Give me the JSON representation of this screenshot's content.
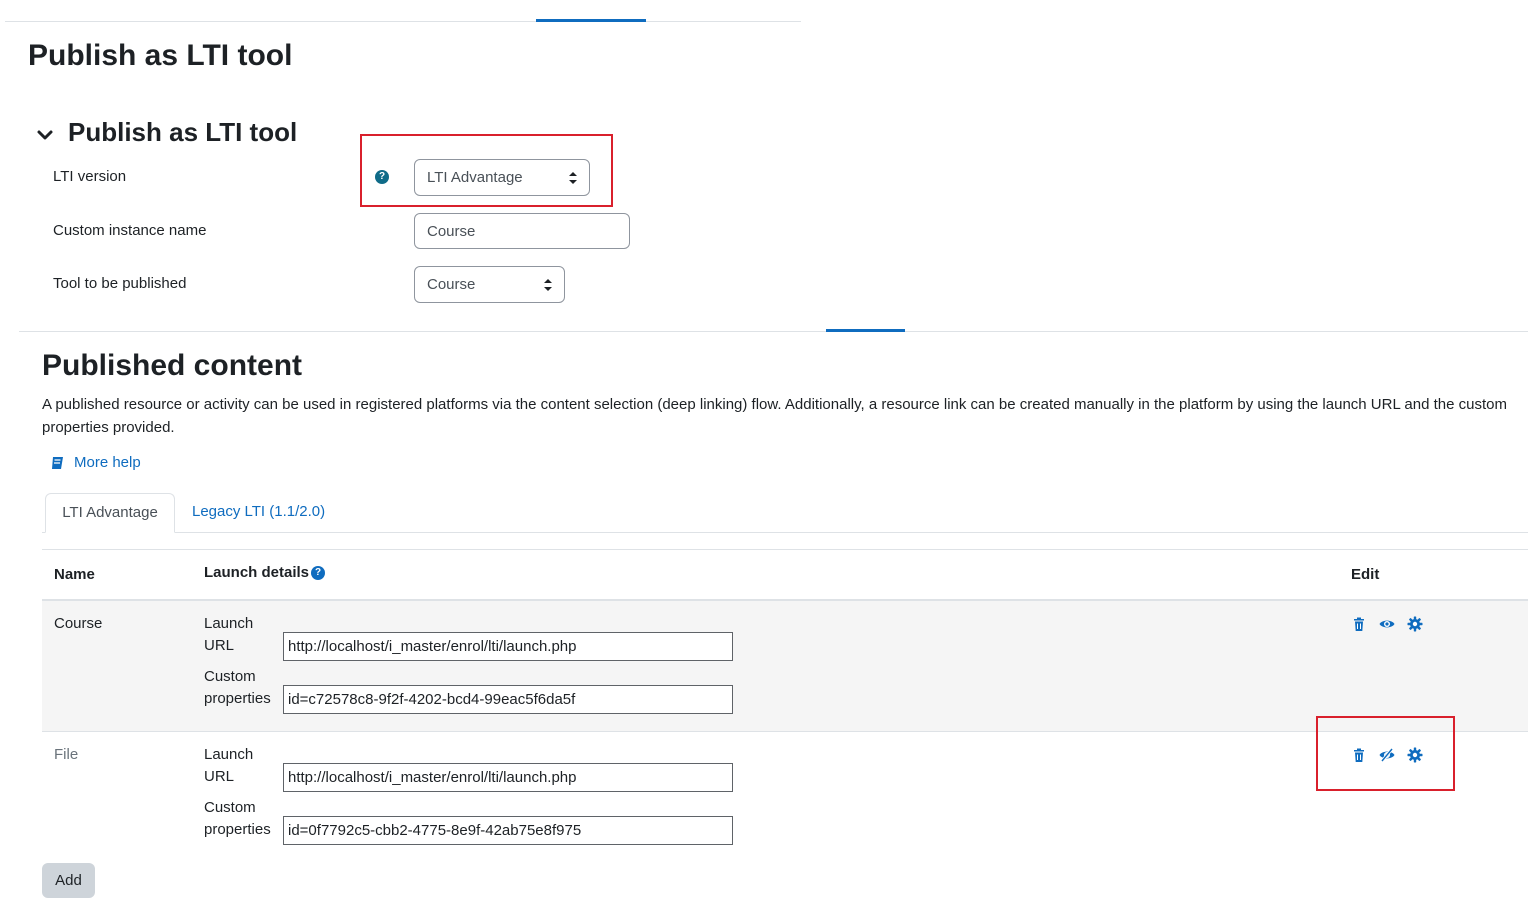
{
  "page": {
    "title": "Publish as LTI tool"
  },
  "section": {
    "title": "Publish as LTI tool",
    "fields": [
      {
        "label": "LTI version",
        "value": "LTI Advantage"
      },
      {
        "label": "Custom instance name",
        "value": "Course"
      },
      {
        "label": "Tool to be published",
        "value": "Course"
      }
    ]
  },
  "published": {
    "title": "Published content",
    "description": "A published resource or activity can be used in registered platforms via the content selection (deep linking) flow. Additionally, a resource link can be created manually in the platform by using the launch URL and the custom properties provided.",
    "more_help": "More help",
    "tabs": [
      "LTI Advantage",
      "Legacy LTI (1.1/2.0)"
    ],
    "table": {
      "headers": {
        "name": "Name",
        "launch": "Launch details",
        "edit": "Edit"
      },
      "rows": [
        {
          "name": "Course",
          "launch_label_1": "Launch",
          "launch_label_2": "URL",
          "launch_url": "http://localhost/i_master/enrol/lti/launch.php",
          "custom_label_1": "Custom",
          "custom_label_2": "properties",
          "custom_props": "id=c72578c8-9f2f-4202-bcd4-99eac5f6da5f",
          "visibility_icon": "eye-icon"
        },
        {
          "name": "File",
          "launch_label_1": "Launch",
          "launch_label_2": "URL",
          "launch_url": "http://localhost/i_master/enrol/lti/launch.php",
          "custom_label_1": "Custom",
          "custom_label_2": "properties",
          "custom_props": "id=0f7792c5-cbb2-4775-8e9f-42ab75e8f975",
          "visibility_icon": "eye-slash-icon"
        }
      ]
    },
    "add_button": "Add"
  },
  "colors": {
    "link": "#0f6cbf",
    "highlight": "#d9202c"
  }
}
